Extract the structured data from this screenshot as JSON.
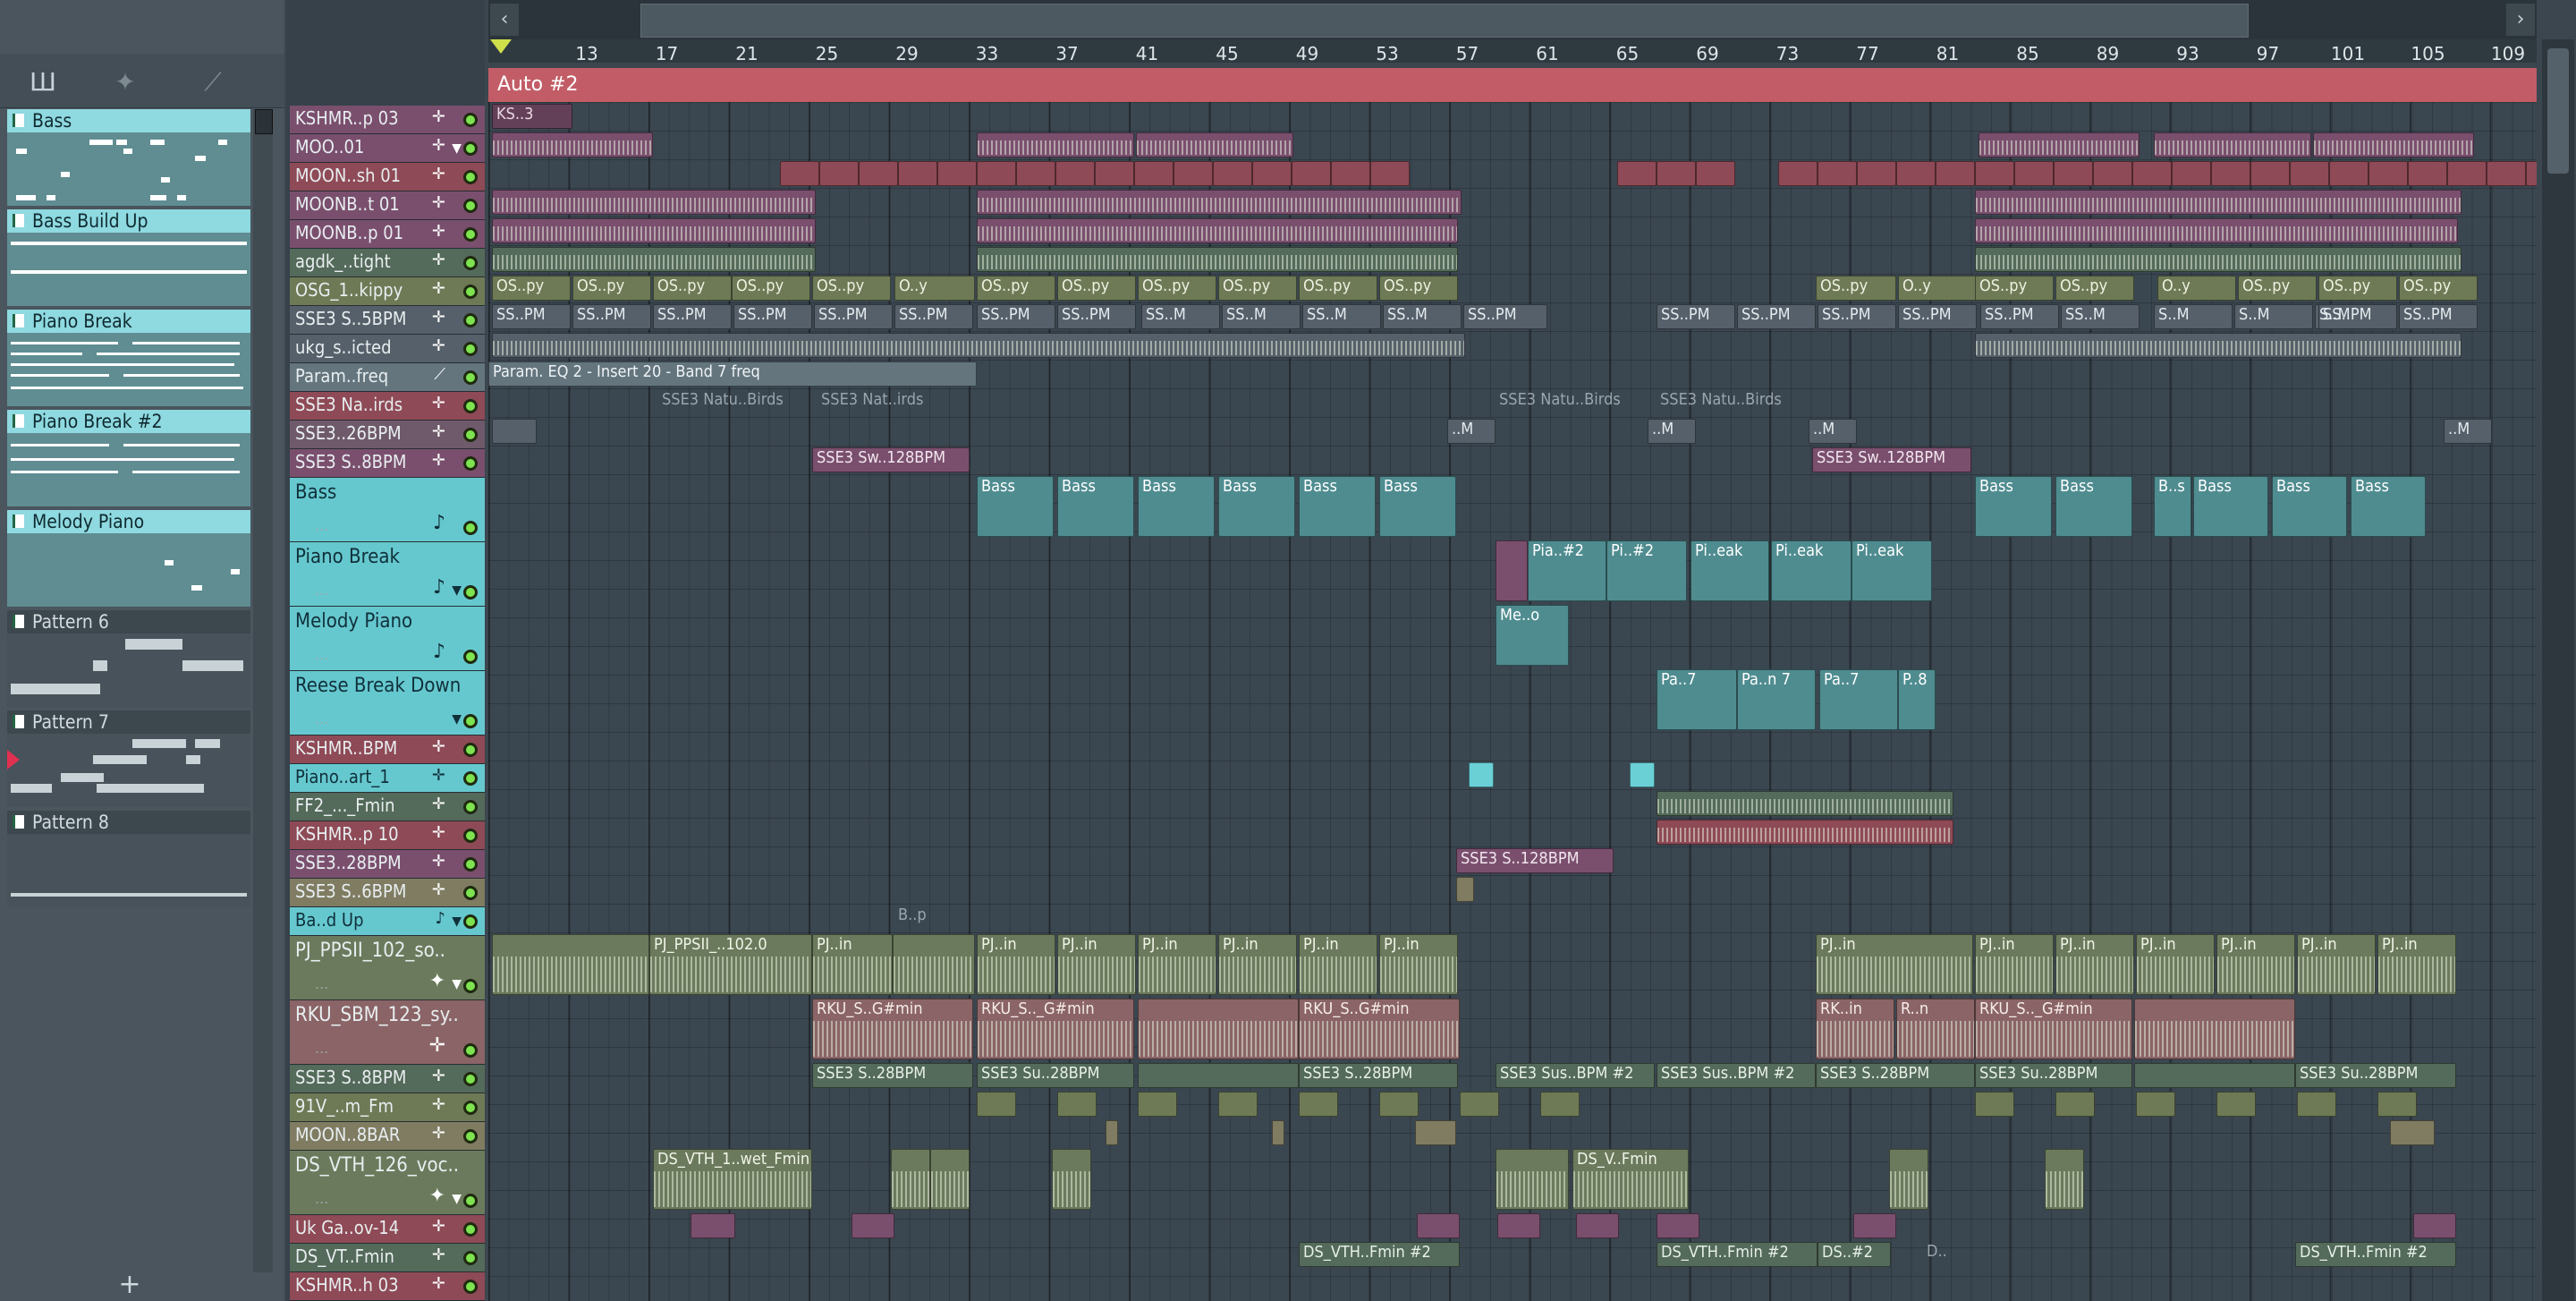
{
  "left_panel": {
    "toolbar_icons": [
      "piano-roll-icon",
      "waveform-icon",
      "automation-icon"
    ],
    "patterns": [
      {
        "label": "Bass",
        "selected": true
      },
      {
        "label": "Bass Build Up",
        "selected": true
      },
      {
        "label": "Piano Break",
        "selected": true
      },
      {
        "label": "Piano Break #2",
        "selected": true
      },
      {
        "label": "Melody Piano",
        "selected": true
      },
      {
        "label": "Pattern 6",
        "selected": false
      },
      {
        "label": "Pattern 7",
        "selected": false
      },
      {
        "label": "Pattern 8",
        "selected": false
      }
    ],
    "add_symbol": "+"
  },
  "tools": {
    "add": "+",
    "delete": "✕",
    "draw": "⁄",
    "resize": "↔"
  },
  "ruler": {
    "bars": [
      "13",
      "17",
      "21",
      "25",
      "29",
      "33",
      "37",
      "41",
      "45",
      "49",
      "53",
      "57",
      "61",
      "65",
      "69",
      "73",
      "77",
      "81",
      "85",
      "89",
      "93",
      "97",
      "101",
      "105",
      "109"
    ]
  },
  "automation_bar": {
    "label": "Auto #2"
  },
  "tracks": [
    {
      "name": "KSHMR..p 03",
      "icon": "✛",
      "tall": false
    },
    {
      "name": "MOO..01",
      "icon": "✛",
      "tall": false,
      "arrow": true
    },
    {
      "name": "MOON..sh 01",
      "icon": "✛",
      "tall": false
    },
    {
      "name": "MOONB..t 01",
      "icon": "✛",
      "tall": false
    },
    {
      "name": "MOONB..p 01",
      "icon": "✛",
      "tall": false
    },
    {
      "name": "agdk_..tight",
      "icon": "✛",
      "tall": false
    },
    {
      "name": "OSG_1..kippy",
      "icon": "✛",
      "tall": false
    },
    {
      "name": "SSE3 S..5BPM",
      "icon": "✛",
      "tall": false
    },
    {
      "name": "ukg_s..icted",
      "icon": "✛",
      "tall": false
    },
    {
      "name": "Param..freq",
      "icon": "⟋",
      "tall": false
    },
    {
      "name": "SSE3 Na..irds",
      "icon": "✛",
      "tall": false
    },
    {
      "name": "SSE3..26BPM",
      "icon": "✛",
      "tall": false
    },
    {
      "name": "SSE3 S..8BPM",
      "icon": "✛",
      "tall": false
    },
    {
      "name": "Bass",
      "icon": "♪",
      "tall": true,
      "dots": "..."
    },
    {
      "name": "Piano Break",
      "icon": "♪",
      "tall": true,
      "dots": "...",
      "arrow": true
    },
    {
      "name": "Melody Piano",
      "icon": "♪",
      "tall": true,
      "dots": "..."
    },
    {
      "name": "Reese Break Down",
      "icon": "",
      "tall": true,
      "dots": "...",
      "arrow": true
    },
    {
      "name": "KSHMR..BPM",
      "icon": "✛",
      "tall": false
    },
    {
      "name": "Piano..art_1",
      "icon": "✛",
      "tall": false
    },
    {
      "name": "FF2_..._Fmin",
      "icon": "✛",
      "tall": false
    },
    {
      "name": "KSHMR..p 10",
      "icon": "✛",
      "tall": false
    },
    {
      "name": "SSE3..28BPM",
      "icon": "✛",
      "tall": false
    },
    {
      "name": "SSE3 S..6BPM",
      "icon": "✛",
      "tall": false
    },
    {
      "name": "Ba..d Up",
      "icon": "♪",
      "tall": false,
      "arrow": true
    },
    {
      "name": "PJ_PPSII_102_so..",
      "icon": "✦",
      "tall": true,
      "dots": "...",
      "arrow": true
    },
    {
      "name": "RKU_SBM_123_sy..",
      "icon": "✛",
      "tall": true,
      "dots": "..."
    },
    {
      "name": "SSE3 S..8BPM",
      "icon": "✛",
      "tall": false
    },
    {
      "name": "91V_..m_Fm",
      "icon": "✛",
      "tall": false
    },
    {
      "name": "MOON..8BAR",
      "icon": "✛",
      "tall": false
    },
    {
      "name": "DS_VTH_126_voc..",
      "icon": "✦",
      "tall": true,
      "dots": "...",
      "arrow": true
    },
    {
      "name": "Uk Ga..ov-14",
      "icon": "✛",
      "tall": false
    },
    {
      "name": "DS_VT..Fmin",
      "icon": "✛",
      "tall": false
    },
    {
      "name": "KSHMR..h 03",
      "icon": "✛",
      "tall": false
    }
  ],
  "clips": {
    "ks3": "KS..3",
    "osg": "OS..py",
    "osg_short": "O..y",
    "sse_pm": "SS..PM",
    "sse_m": "SS..M",
    "sse_m2": "S..M",
    "param": "Param. EQ 2 - Insert 20 - Band 7 freq",
    "birds1": "SSE3 Natu..Birds",
    "birds2": "SSE3 Nat..irds",
    "sse_dm": "..M",
    "sw128": "SSE3 Sw..128BPM",
    "bass": "Bass",
    "bass_short": "B..s",
    "pia2": "Pia..#2",
    "pi2": "Pi..#2",
    "pieak": "Pi..eak",
    "meo": "Me..o",
    "pa7": "Pa..7",
    "pan7": "Pa..n 7",
    "p8": "P..8",
    "sse128": "SSE3 S..128BPM",
    "bp": "B..p",
    "pj102": "PJ_PPSII_..102.0",
    "pjin": "PJ..in",
    "rku": "RKU_S.._G#min",
    "rku_short": "RKU_S..G#min",
    "rkin": "RK..in",
    "rn": "R..n",
    "sse28": "SSE3 S..28BPM",
    "sus28": "SSE3 Su..28BPM",
    "susbpm": "SSE3 Sus..BPM #2",
    "dsvth1": "DS_VTH_1..wet_Fmin",
    "dsv": "DS_V..Fmin",
    "dsfmin": "DS_VTH..Fmin #2",
    "ds2": "DS..#2",
    "dd": "D..",
    "pjin2": "PJ..in"
  },
  "colors": {
    "accent_teal": "#6ad0d6",
    "auto_bar": "#c25d67",
    "led_green": "#7de34f",
    "background": "#3b464f"
  }
}
